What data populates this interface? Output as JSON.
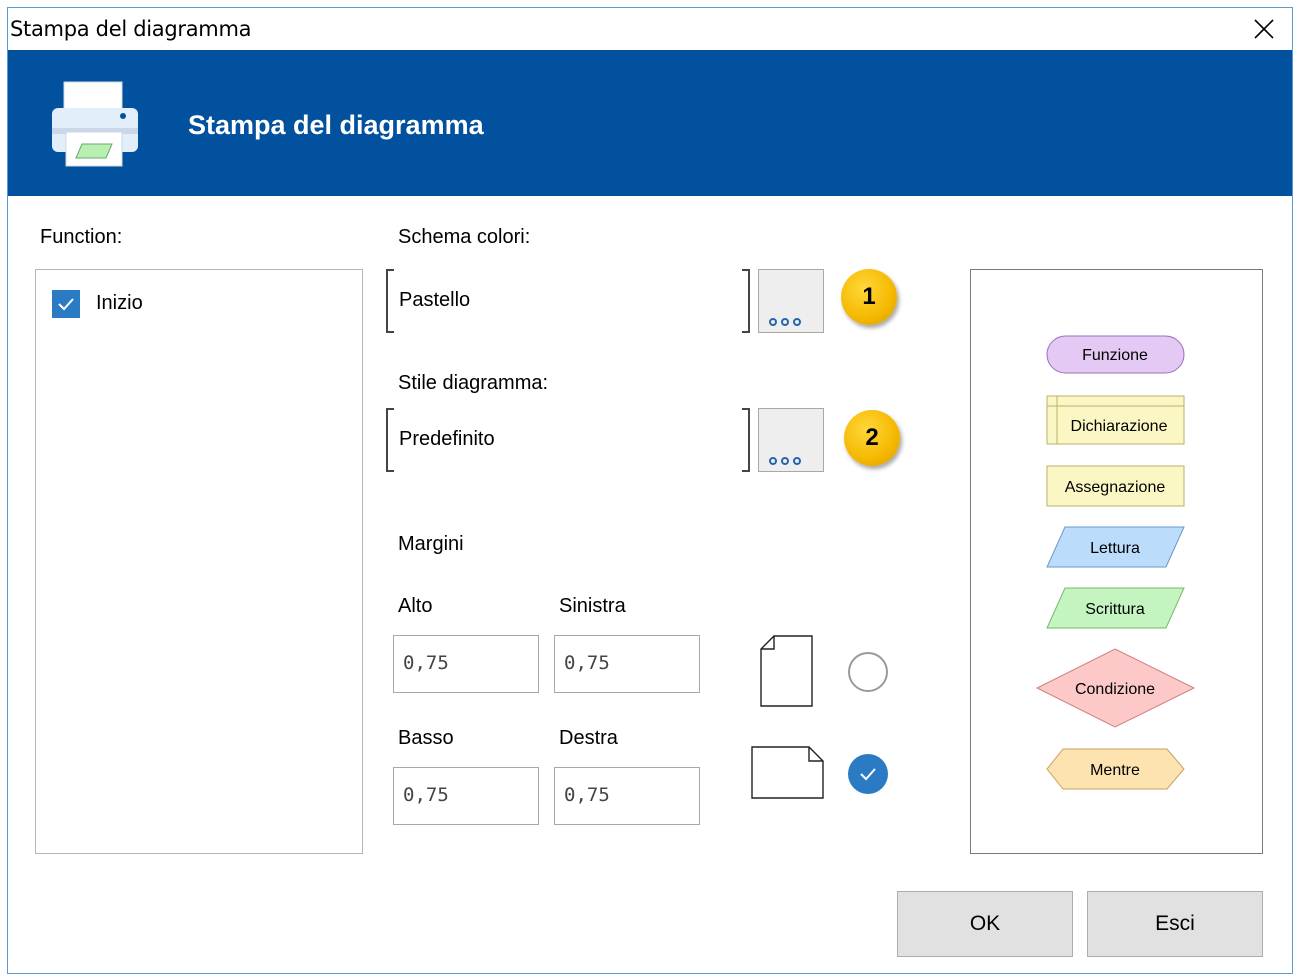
{
  "window": {
    "title": "Stampa del diagramma"
  },
  "banner": {
    "title": "Stampa del diagramma"
  },
  "function_section": {
    "label": "Function:",
    "items": [
      {
        "label": "Inizio",
        "checked": true
      }
    ]
  },
  "color_scheme": {
    "label": "Schema colori:",
    "value": "Pastello",
    "badge": "1"
  },
  "diagram_style": {
    "label": "Stile diagramma:",
    "value": "Predefinito",
    "badge": "2"
  },
  "margins": {
    "label": "Margini",
    "top_label": "Alto",
    "top_value": "0,75",
    "left_label": "Sinistra",
    "left_value": "0,75",
    "bottom_label": "Basso",
    "bottom_value": "0,75",
    "right_label": "Destra",
    "right_value": "0,75"
  },
  "orientation": {
    "portrait_selected": false,
    "landscape_selected": true
  },
  "preview": {
    "shapes": {
      "function": "Funzione",
      "declaration": "Dichiarazione",
      "assignment": "Assegnazione",
      "input": "Lettura",
      "output": "Scrittura",
      "condition": "Condizione",
      "while": "Mentre"
    }
  },
  "buttons": {
    "ok": "OK",
    "cancel": "Esci"
  },
  "colors": {
    "banner": "#02519f",
    "accent": "#2a7bc3",
    "badge": "#f5b800"
  }
}
